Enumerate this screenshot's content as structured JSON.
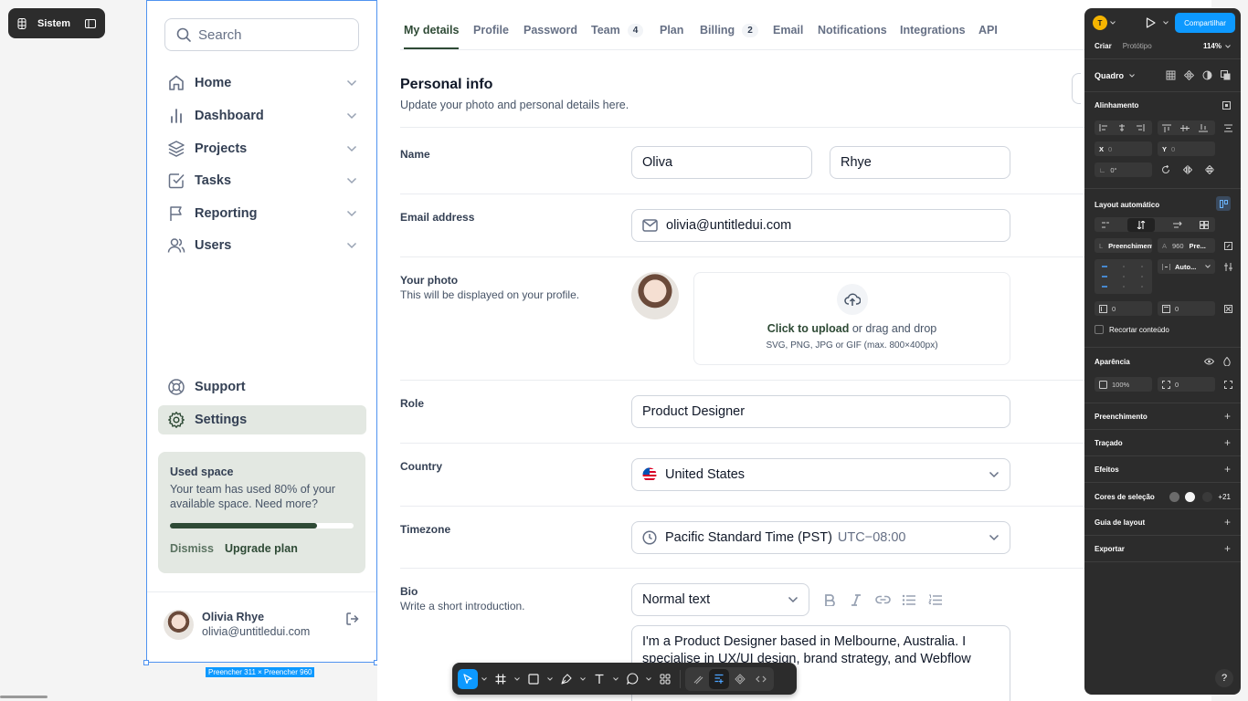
{
  "top_pill": {
    "label": "Sistem"
  },
  "sidebar": {
    "search_placeholder": "Search",
    "nav": [
      {
        "label": "Home",
        "icon": "home-icon"
      },
      {
        "label": "Dashboard",
        "icon": "bar-chart-icon"
      },
      {
        "label": "Projects",
        "icon": "layers-icon"
      },
      {
        "label": "Tasks",
        "icon": "check-square-icon"
      },
      {
        "label": "Reporting",
        "icon": "flag-icon"
      },
      {
        "label": "Users",
        "icon": "users-icon"
      }
    ],
    "support_label": "Support",
    "settings_label": "Settings",
    "card": {
      "title": "Used space",
      "text": "Your team has used 80% of your available space. Need more?",
      "progress": 0.8,
      "dismiss": "Dismiss",
      "upgrade": "Upgrade plan"
    },
    "user": {
      "name": "Olivia Rhye",
      "email": "olivia@untitledui.com"
    }
  },
  "selection_label": "Preencher 311 × Preencher 960",
  "tabs": [
    {
      "label": "My details",
      "active": true
    },
    {
      "label": "Profile"
    },
    {
      "label": "Password"
    },
    {
      "label": "Team",
      "count": "4"
    },
    {
      "label": "Plan"
    },
    {
      "label": "Billing",
      "count": "2"
    },
    {
      "label": "Email"
    },
    {
      "label": "Notifications"
    },
    {
      "label": "Integrations"
    },
    {
      "label": "API"
    }
  ],
  "form": {
    "section_title": "Personal info",
    "section_sub": "Update your photo and personal details here.",
    "name_label": "Name",
    "first_name": "Oliva",
    "last_name": "Rhye",
    "email_label": "Email address",
    "email": "olivia@untitledui.com",
    "photo_label": "Your photo",
    "photo_sub": "This will be displayed on your profile.",
    "upload_link": "Click to upload",
    "upload_rest": " or drag and drop",
    "upload_hint": "SVG, PNG, JPG or GIF (max. 800×400px)",
    "role_label": "Role",
    "role": "Product Designer",
    "country_label": "Country",
    "country": "United States",
    "timezone_label": "Timezone",
    "timezone": "Pacific Standard Time (PST)",
    "timezone_offset": "UTC−08:00",
    "bio_label": "Bio",
    "bio_sub": "Write a short introduction.",
    "text_style": "Normal text",
    "bio_text": "I'm a Product Designer based in Melbourne, Australia. I specialise in UX/UI design, brand strategy, and Webflow"
  },
  "panel": {
    "avatar_letter": "T",
    "share": "Compartilhar",
    "tab_create": "Criar",
    "tab_prototype": "Protótipo",
    "zoom": "114%",
    "frame": "Quadro",
    "alignment": "Alinhamento",
    "x_label": "X",
    "x_value": "0",
    "y_label": "Y",
    "y_value": "0",
    "rotation": "0°",
    "autolayout": "Layout automático",
    "w_prefix": "L",
    "w_value": "Preenchimento",
    "h_prefix": "A",
    "h_value": "960",
    "h_suffix": "Pre...",
    "gap": "Auto...",
    "pad1": "0",
    "pad2": "0",
    "clip": "Recortar conteúdo",
    "appearance": "Aparência",
    "opacity": "100%",
    "radius": "0",
    "fill": "Preenchimento",
    "stroke": "Traçado",
    "effects": "Efeitos",
    "selection_colors": "Cores de seleção",
    "more_colors": "+21",
    "layout_guide": "Guia de layout",
    "export": "Exportar",
    "help": "?"
  }
}
